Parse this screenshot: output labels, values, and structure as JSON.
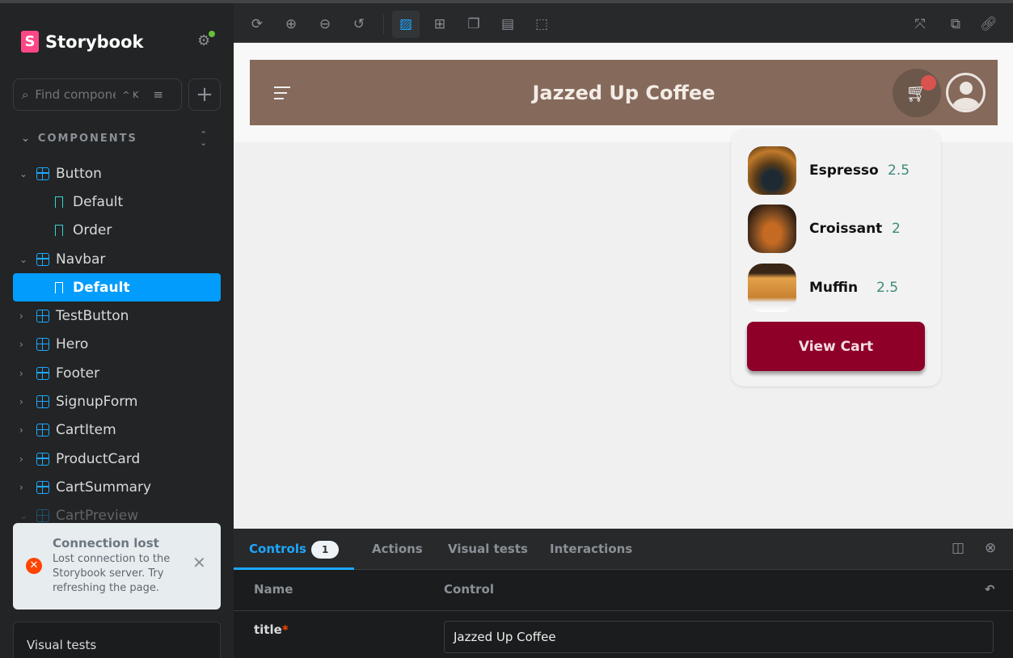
{
  "app": {
    "name": "Storybook",
    "logo_letter": "S"
  },
  "sidebar": {
    "search_placeholder": "Find components",
    "shortcut": "^ K",
    "section": "COMPONENTS",
    "tree": [
      {
        "label": "Button",
        "type": "component",
        "expanded": true
      },
      {
        "label": "Default",
        "type": "story"
      },
      {
        "label": "Order",
        "type": "story"
      },
      {
        "label": "Navbar",
        "type": "component",
        "expanded": true
      },
      {
        "label": "Default",
        "type": "story",
        "selected": true
      },
      {
        "label": "TestButton",
        "type": "component"
      },
      {
        "label": "Hero",
        "type": "component"
      },
      {
        "label": "Footer",
        "type": "component"
      },
      {
        "label": "SignupForm",
        "type": "component"
      },
      {
        "label": "CartItem",
        "type": "component"
      },
      {
        "label": "ProductCard",
        "type": "component"
      },
      {
        "label": "CartSummary",
        "type": "component"
      },
      {
        "label": "CartPreview",
        "type": "component",
        "expanded": true
      }
    ],
    "toast": {
      "title": "Connection lost",
      "message": "Lost connection to the Storybook server. Try refreshing the page."
    },
    "visual_tests": "Visual tests"
  },
  "preview": {
    "title": "Jazzed Up Coffee",
    "items": [
      {
        "name": "Espresso",
        "price": "2.5"
      },
      {
        "name": "Croissant",
        "price": "2"
      },
      {
        "name": "Muffin",
        "price": "2.5"
      }
    ],
    "view_cart": "View Cart",
    "colors": {
      "navbar": "#85695a",
      "button": "#8e0028",
      "price": "#3c8a7a"
    }
  },
  "panel": {
    "tabs": [
      {
        "label": "Controls",
        "count": "1"
      },
      {
        "label": "Actions"
      },
      {
        "label": "Visual tests"
      },
      {
        "label": "Interactions"
      }
    ],
    "col_name": "Name",
    "col_control": "Control",
    "row": {
      "name": "title",
      "required": "*",
      "value": "Jazzed Up Coffee"
    }
  }
}
